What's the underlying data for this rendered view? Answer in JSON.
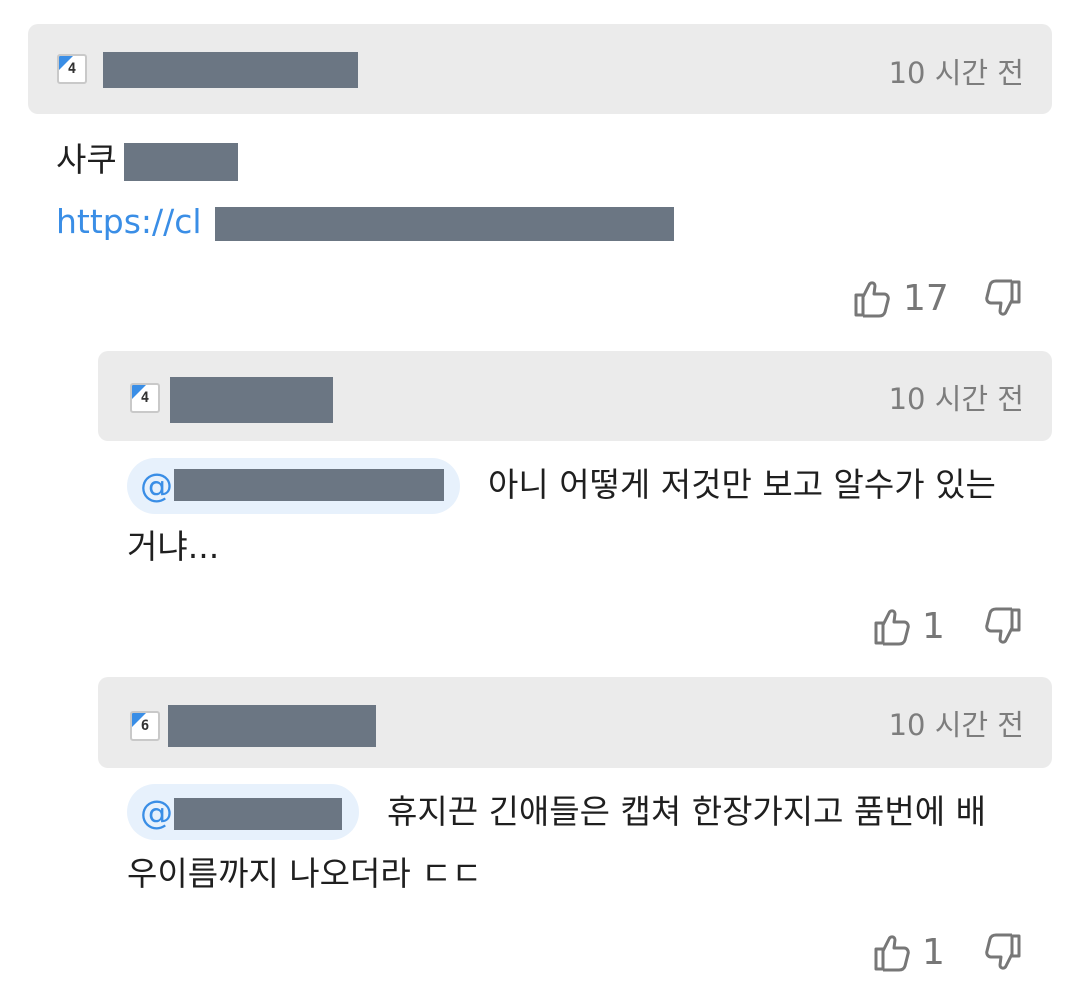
{
  "comments": [
    {
      "level_badge": "4",
      "time": "10 시간 전",
      "text_prefix": "사쿠",
      "link_prefix": "https://cl",
      "likes": "17"
    },
    {
      "level_badge": "4",
      "time": "10 시간 전",
      "mention_at": "@",
      "text_line1": "아니 어떻게 저것만 보고 알수가 있는",
      "text_line2": "거냐...",
      "likes": "1"
    },
    {
      "level_badge": "6",
      "time": "10 시간 전",
      "mention_at": "@",
      "text_line1": "휴지끈 긴애들은 캡쳐 한장가지고 품번에 배",
      "text_line2": "우이름까지 나오더라 ㄷㄷ",
      "likes": "1"
    }
  ],
  "icons": {
    "like": "thumbs-up-icon",
    "dislike": "thumbs-down-icon",
    "level": "level-badge-icon"
  },
  "colors": {
    "link": "#3a8ee6",
    "header_bg": "#ebebeb",
    "mention_bg": "#e7f1fc",
    "redaction": "#6b7683"
  }
}
